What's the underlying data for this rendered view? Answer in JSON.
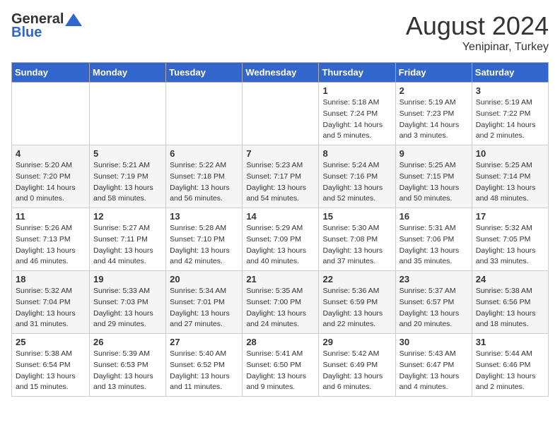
{
  "header": {
    "logo_general": "General",
    "logo_blue": "Blue",
    "month_year": "August 2024",
    "location": "Yenipinar, Turkey"
  },
  "days_of_week": [
    "Sunday",
    "Monday",
    "Tuesday",
    "Wednesday",
    "Thursday",
    "Friday",
    "Saturday"
  ],
  "weeks": [
    [
      {
        "day": "",
        "info": ""
      },
      {
        "day": "",
        "info": ""
      },
      {
        "day": "",
        "info": ""
      },
      {
        "day": "",
        "info": ""
      },
      {
        "day": "1",
        "info": "Sunrise: 5:18 AM\nSunset: 7:24 PM\nDaylight: 14 hours\nand 5 minutes."
      },
      {
        "day": "2",
        "info": "Sunrise: 5:19 AM\nSunset: 7:23 PM\nDaylight: 14 hours\nand 3 minutes."
      },
      {
        "day": "3",
        "info": "Sunrise: 5:19 AM\nSunset: 7:22 PM\nDaylight: 14 hours\nand 2 minutes."
      }
    ],
    [
      {
        "day": "4",
        "info": "Sunrise: 5:20 AM\nSunset: 7:20 PM\nDaylight: 14 hours\nand 0 minutes."
      },
      {
        "day": "5",
        "info": "Sunrise: 5:21 AM\nSunset: 7:19 PM\nDaylight: 13 hours\nand 58 minutes."
      },
      {
        "day": "6",
        "info": "Sunrise: 5:22 AM\nSunset: 7:18 PM\nDaylight: 13 hours\nand 56 minutes."
      },
      {
        "day": "7",
        "info": "Sunrise: 5:23 AM\nSunset: 7:17 PM\nDaylight: 13 hours\nand 54 minutes."
      },
      {
        "day": "8",
        "info": "Sunrise: 5:24 AM\nSunset: 7:16 PM\nDaylight: 13 hours\nand 52 minutes."
      },
      {
        "day": "9",
        "info": "Sunrise: 5:25 AM\nSunset: 7:15 PM\nDaylight: 13 hours\nand 50 minutes."
      },
      {
        "day": "10",
        "info": "Sunrise: 5:25 AM\nSunset: 7:14 PM\nDaylight: 13 hours\nand 48 minutes."
      }
    ],
    [
      {
        "day": "11",
        "info": "Sunrise: 5:26 AM\nSunset: 7:13 PM\nDaylight: 13 hours\nand 46 minutes."
      },
      {
        "day": "12",
        "info": "Sunrise: 5:27 AM\nSunset: 7:11 PM\nDaylight: 13 hours\nand 44 minutes."
      },
      {
        "day": "13",
        "info": "Sunrise: 5:28 AM\nSunset: 7:10 PM\nDaylight: 13 hours\nand 42 minutes."
      },
      {
        "day": "14",
        "info": "Sunrise: 5:29 AM\nSunset: 7:09 PM\nDaylight: 13 hours\nand 40 minutes."
      },
      {
        "day": "15",
        "info": "Sunrise: 5:30 AM\nSunset: 7:08 PM\nDaylight: 13 hours\nand 37 minutes."
      },
      {
        "day": "16",
        "info": "Sunrise: 5:31 AM\nSunset: 7:06 PM\nDaylight: 13 hours\nand 35 minutes."
      },
      {
        "day": "17",
        "info": "Sunrise: 5:32 AM\nSunset: 7:05 PM\nDaylight: 13 hours\nand 33 minutes."
      }
    ],
    [
      {
        "day": "18",
        "info": "Sunrise: 5:32 AM\nSunset: 7:04 PM\nDaylight: 13 hours\nand 31 minutes."
      },
      {
        "day": "19",
        "info": "Sunrise: 5:33 AM\nSunset: 7:03 PM\nDaylight: 13 hours\nand 29 minutes."
      },
      {
        "day": "20",
        "info": "Sunrise: 5:34 AM\nSunset: 7:01 PM\nDaylight: 13 hours\nand 27 minutes."
      },
      {
        "day": "21",
        "info": "Sunrise: 5:35 AM\nSunset: 7:00 PM\nDaylight: 13 hours\nand 24 minutes."
      },
      {
        "day": "22",
        "info": "Sunrise: 5:36 AM\nSunset: 6:59 PM\nDaylight: 13 hours\nand 22 minutes."
      },
      {
        "day": "23",
        "info": "Sunrise: 5:37 AM\nSunset: 6:57 PM\nDaylight: 13 hours\nand 20 minutes."
      },
      {
        "day": "24",
        "info": "Sunrise: 5:38 AM\nSunset: 6:56 PM\nDaylight: 13 hours\nand 18 minutes."
      }
    ],
    [
      {
        "day": "25",
        "info": "Sunrise: 5:38 AM\nSunset: 6:54 PM\nDaylight: 13 hours\nand 15 minutes."
      },
      {
        "day": "26",
        "info": "Sunrise: 5:39 AM\nSunset: 6:53 PM\nDaylight: 13 hours\nand 13 minutes."
      },
      {
        "day": "27",
        "info": "Sunrise: 5:40 AM\nSunset: 6:52 PM\nDaylight: 13 hours\nand 11 minutes."
      },
      {
        "day": "28",
        "info": "Sunrise: 5:41 AM\nSunset: 6:50 PM\nDaylight: 13 hours\nand 9 minutes."
      },
      {
        "day": "29",
        "info": "Sunrise: 5:42 AM\nSunset: 6:49 PM\nDaylight: 13 hours\nand 6 minutes."
      },
      {
        "day": "30",
        "info": "Sunrise: 5:43 AM\nSunset: 6:47 PM\nDaylight: 13 hours\nand 4 minutes."
      },
      {
        "day": "31",
        "info": "Sunrise: 5:44 AM\nSunset: 6:46 PM\nDaylight: 13 hours\nand 2 minutes."
      }
    ]
  ]
}
